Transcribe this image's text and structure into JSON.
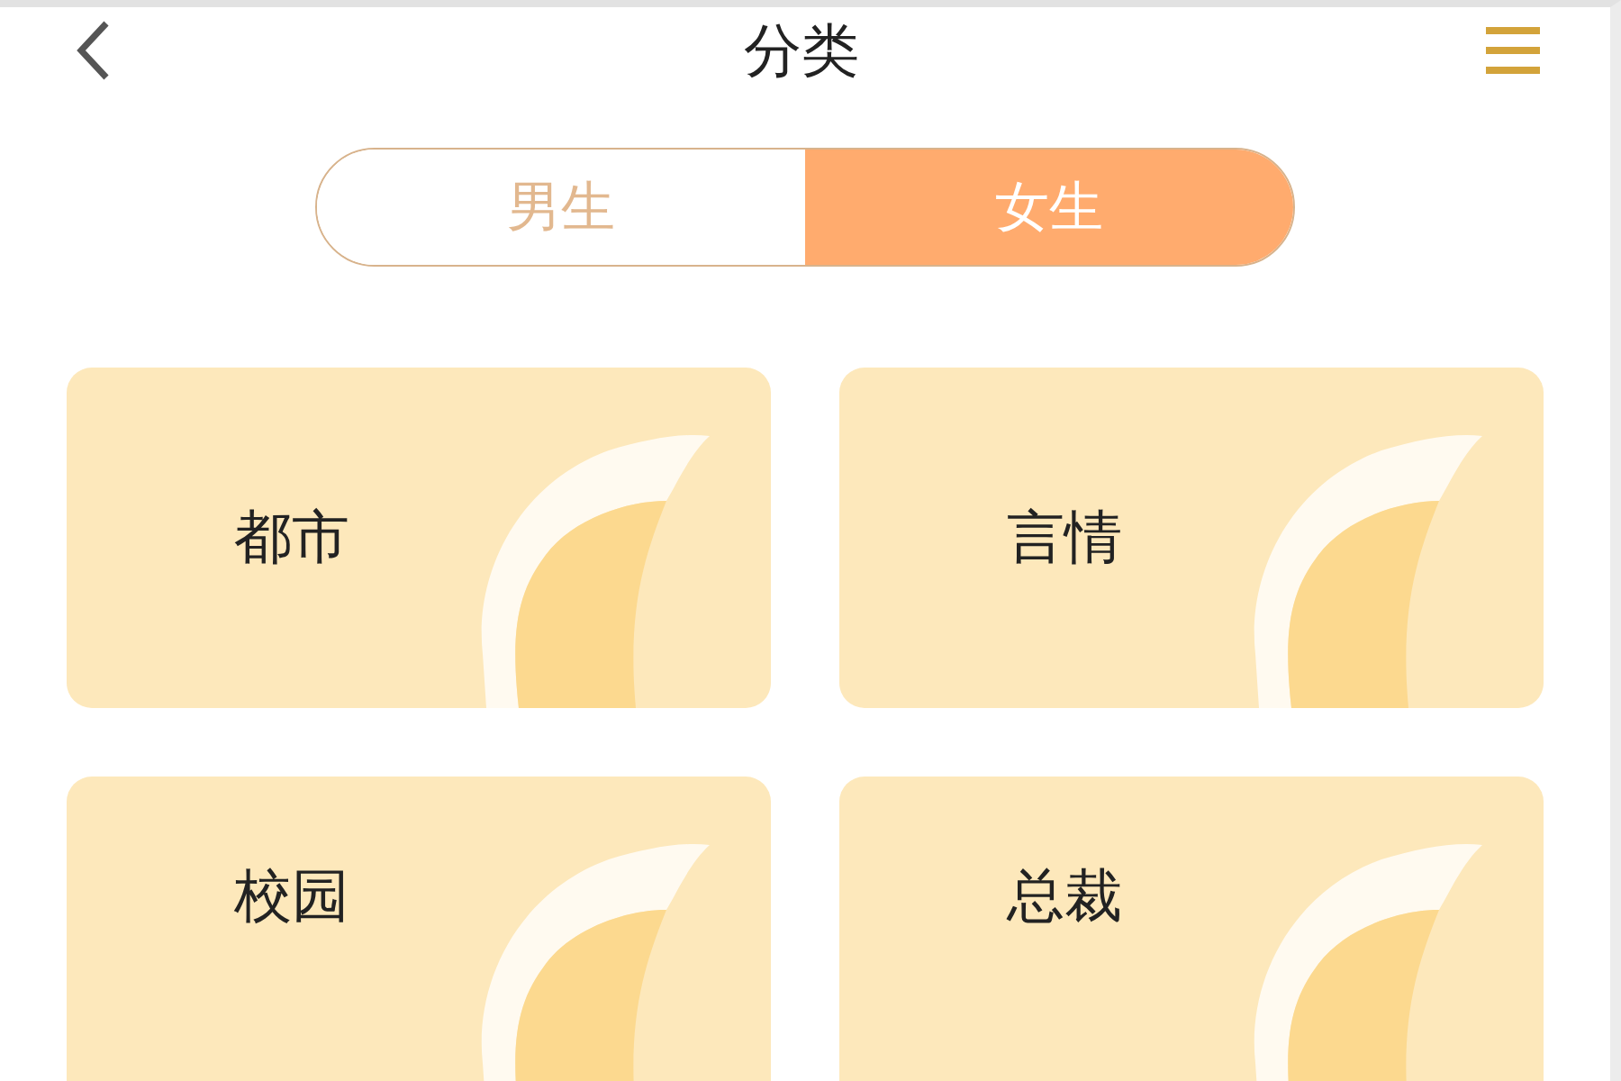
{
  "header": {
    "title": "分类"
  },
  "tabs": [
    {
      "label": "男生",
      "selected": false
    },
    {
      "label": "女生",
      "selected": true
    }
  ],
  "categories": [
    {
      "label": "都市"
    },
    {
      "label": "言情"
    },
    {
      "label": "校园"
    },
    {
      "label": "总裁"
    }
  ]
}
